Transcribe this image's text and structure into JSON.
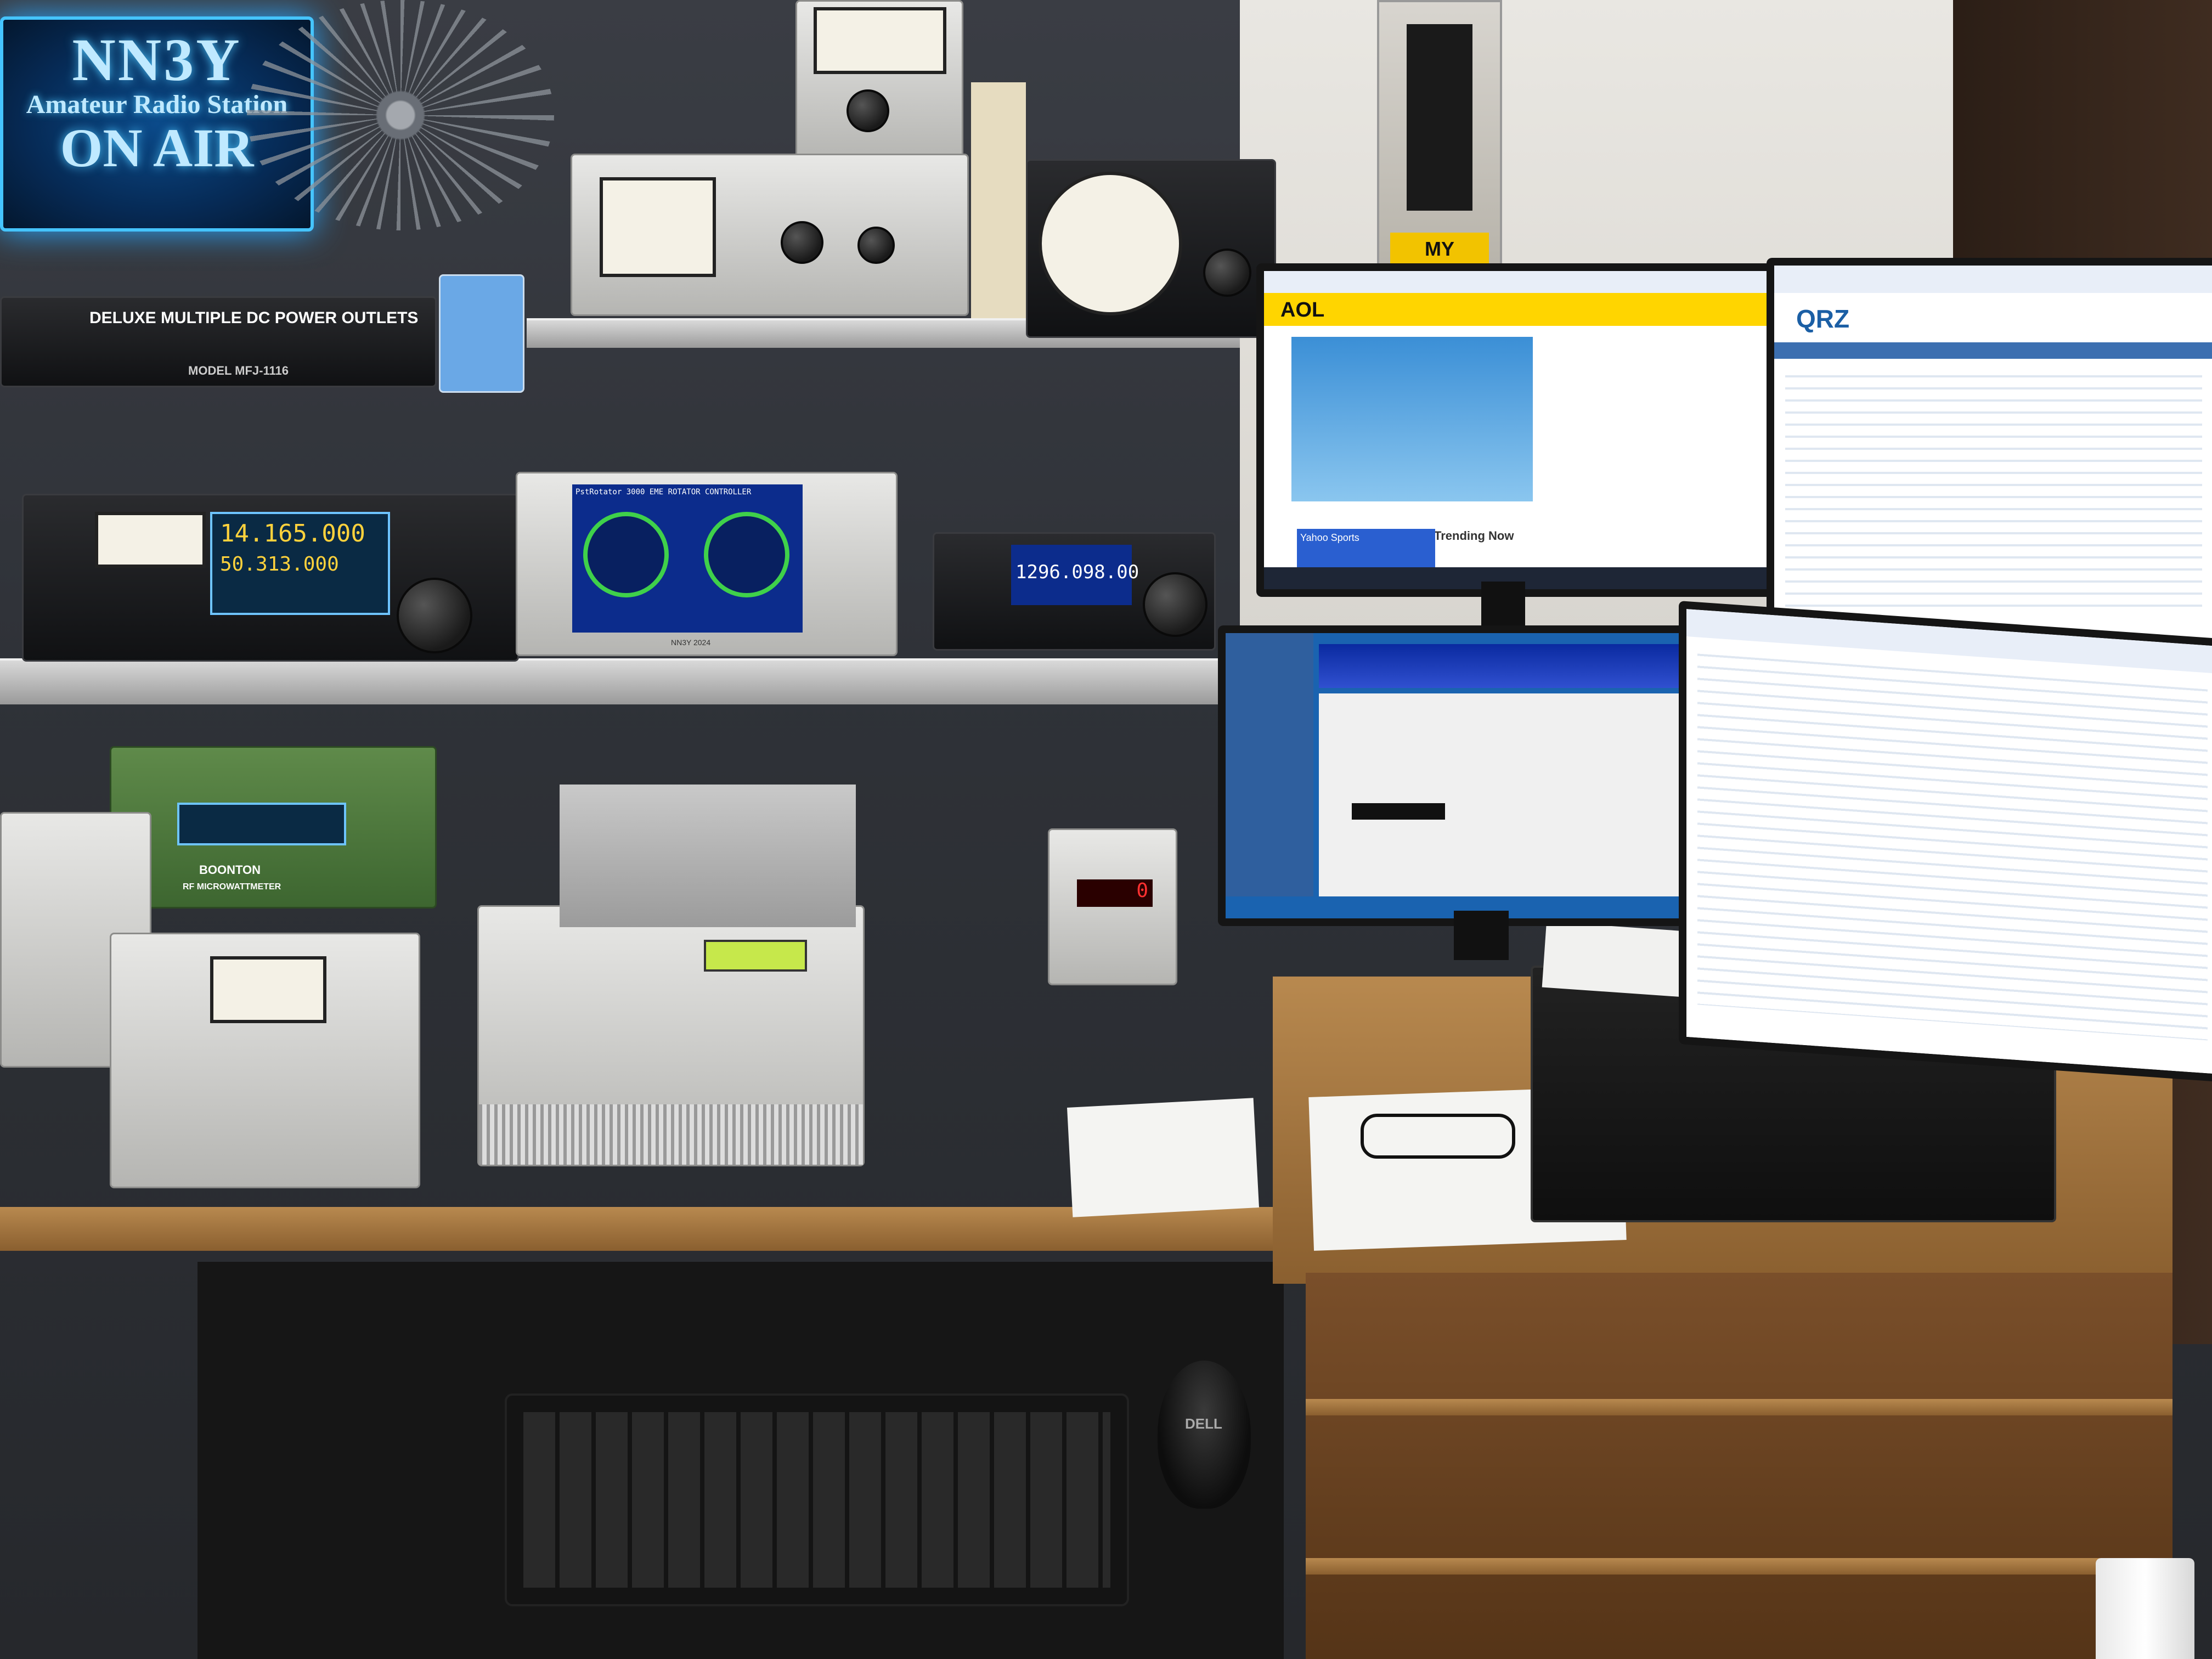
{
  "sign": {
    "callsign": "NN3Y",
    "line2": "Amateur Radio Station",
    "line3": "ON AIR"
  },
  "power_strip": {
    "label": "DELUXE MULTIPLE DC POWER OUTLETS",
    "model": "MODEL MFJ-1116"
  },
  "radio_left": {
    "freq_main": "14.165.000",
    "freq_sub": "50.313.000"
  },
  "rotator_controller": {
    "title": "PstRotator 3000 EME ROTATOR CONTROLLER",
    "brand": "NN3Y 2024"
  },
  "radio_right": {
    "freq": "1296.098.00"
  },
  "counter": {
    "readout": "0"
  },
  "boonton": {
    "brand": "BOONTON",
    "model": "RF MICROWATTMETER"
  },
  "poster": {
    "text": "MY RULES!"
  },
  "monitors": {
    "aol": {
      "logo": "AOL",
      "headline": "Trending Now",
      "sports": "Yahoo Sports"
    },
    "qrz": {
      "logo": "QRZ"
    }
  },
  "mouse": {
    "brand": "DELL"
  },
  "colors": {
    "neon": "#45c4ff",
    "rotator_panel": "#1e3a9e",
    "aol_yellow": "#ffd500"
  }
}
